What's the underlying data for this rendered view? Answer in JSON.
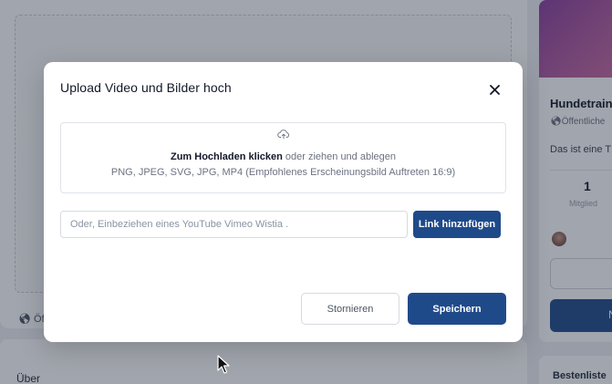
{
  "modal": {
    "title": "Upload Video und Bilder hoch",
    "close_icon": "close-icon",
    "dropzone": {
      "icon": "upload-cloud-icon",
      "click_text": "Zum Hochladen klicken",
      "drag_text": " oder ziehen und ablegen",
      "formats_text": "PNG, JPEG, SVG, JPG, MP4 (Empfohlenes Erscheinungsbild Auftreten 16:9)"
    },
    "url_input": {
      "placeholder": "Oder, Einbeziehen eines YouTube Vimeo Wistia .",
      "value": ""
    },
    "link_button": "Link hinzufügen",
    "cancel_button": "Stornieren",
    "save_button": "Speichern"
  },
  "background": {
    "public_label": "Öff",
    "about_label": "Über",
    "group": {
      "title": "Hundetrain",
      "public_label": "Öffentliche",
      "description": "Das ist eine T",
      "member_count": "1",
      "member_label": "Mitglied",
      "join_label": "N"
    },
    "leaderboard_label": "Bestenliste"
  },
  "colors": {
    "primary": "#1f4a8a",
    "overlay": "#1e293b",
    "banner": "#8a3f9d"
  }
}
